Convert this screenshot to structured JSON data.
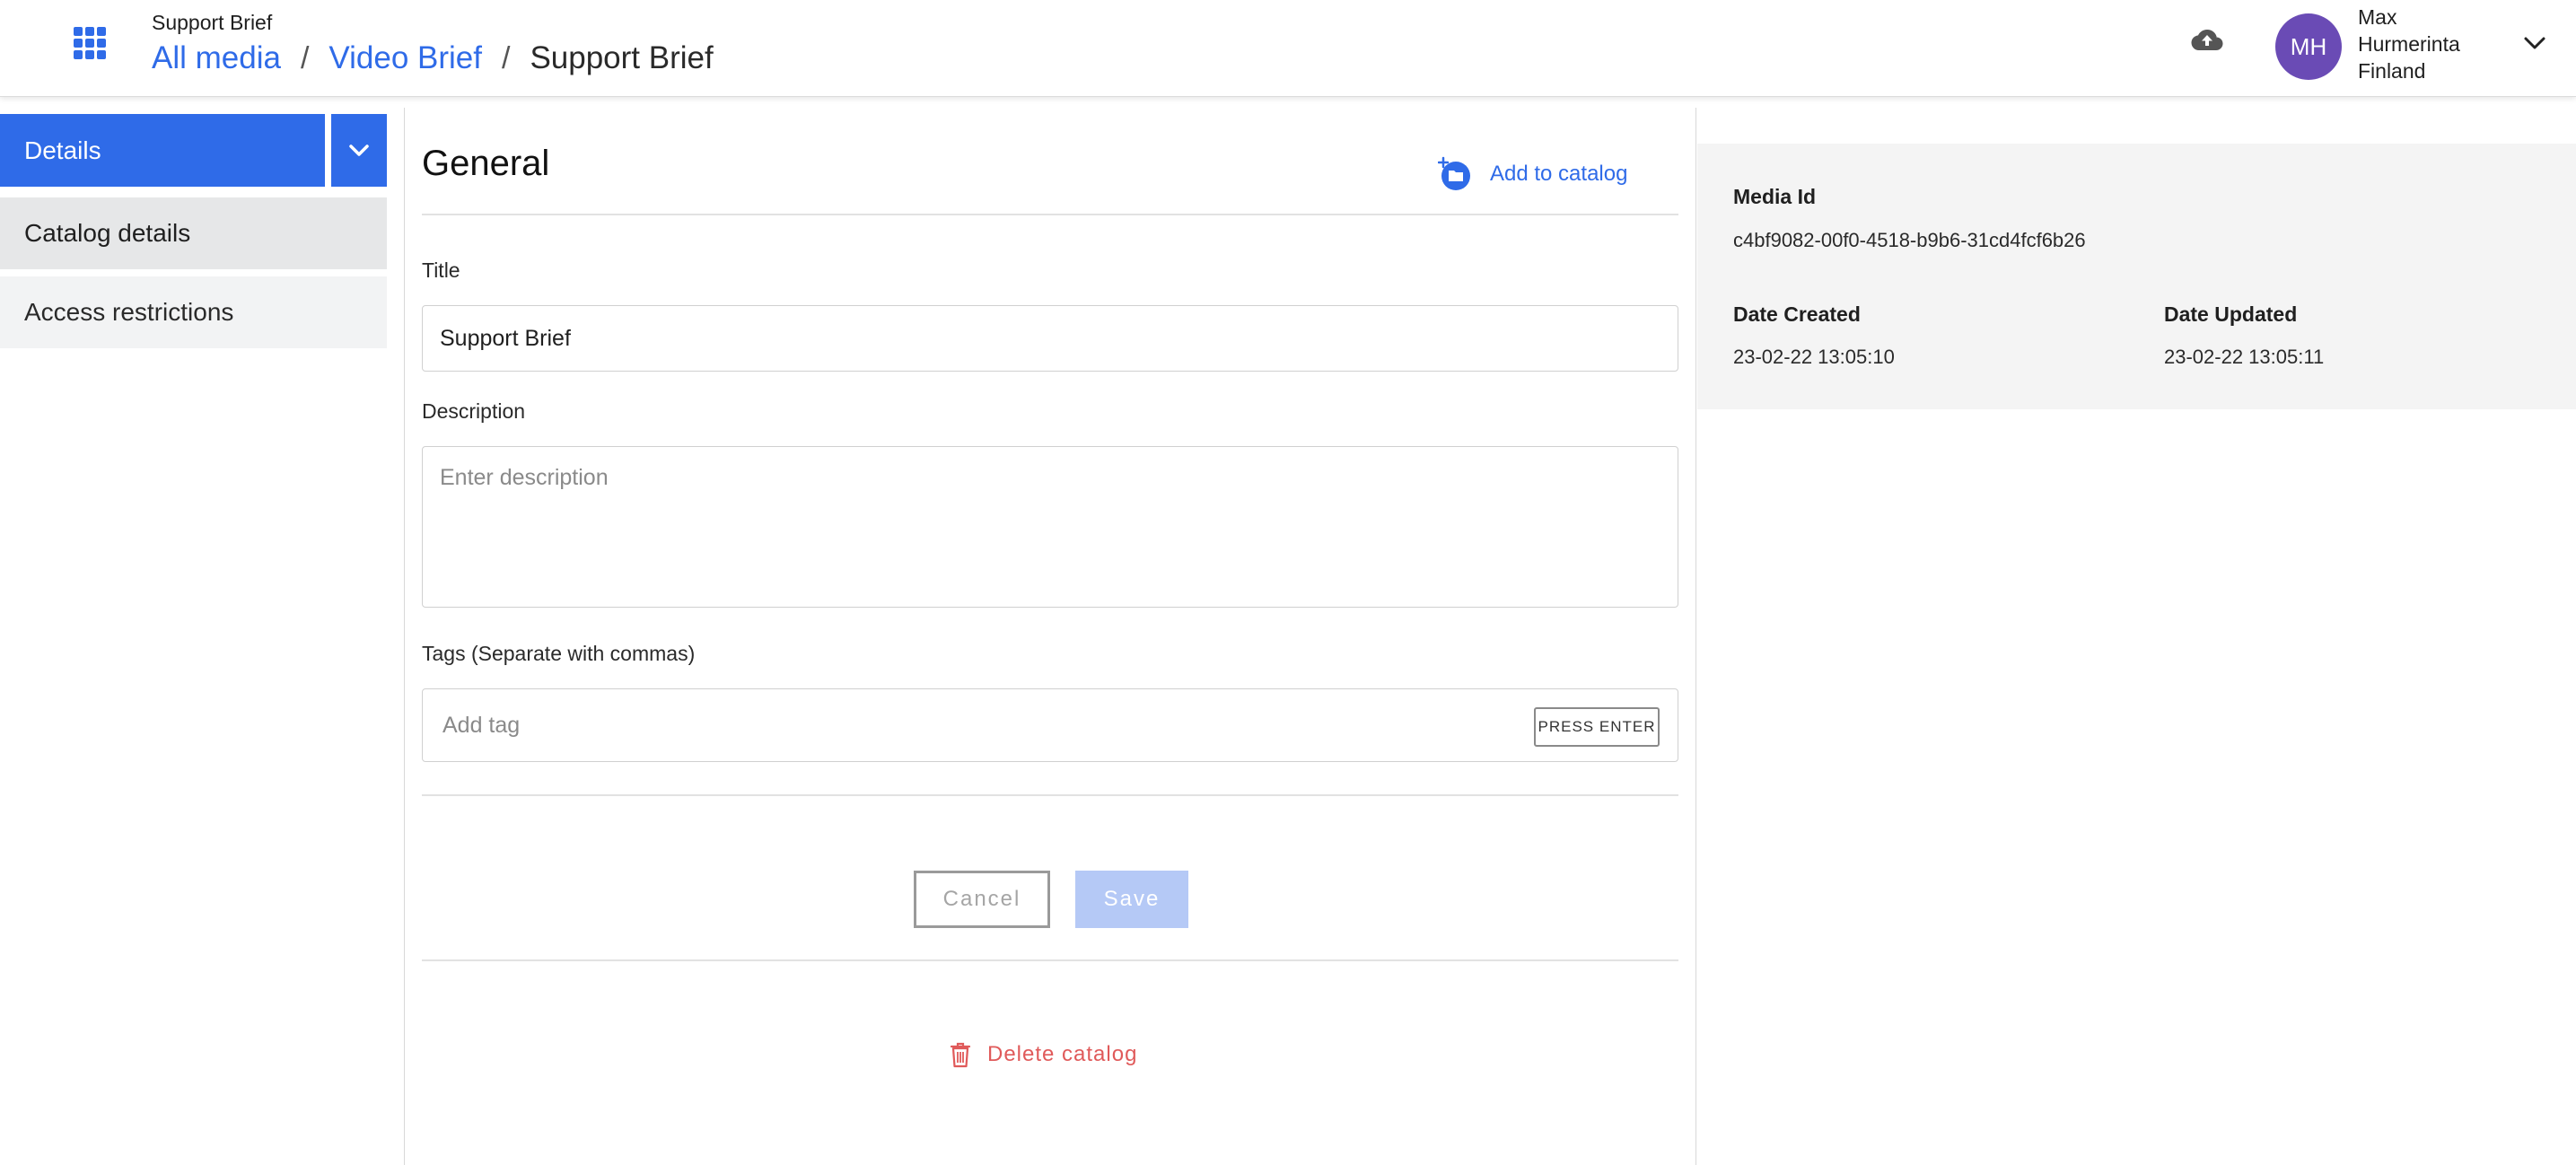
{
  "header": {
    "pre_title": "Support Brief",
    "breadcrumb": [
      {
        "label": "All media"
      },
      {
        "label": "Video Brief"
      },
      {
        "label": "Support Brief"
      }
    ],
    "separator": "/",
    "icons": {
      "apps": "apps-grid-icon",
      "upload": "cloud-upload-icon",
      "menu": "chevron-down-icon"
    },
    "user": {
      "initials": "MH",
      "first_name": "Max",
      "last_name": "Hurmerinta",
      "location": "Finland",
      "avatar_color": "#6a4bb5"
    }
  },
  "sidebar": {
    "selected": "Details",
    "items": [
      {
        "label": "Catalog details",
        "active": true
      },
      {
        "label": "Access restrictions",
        "active": false
      }
    ]
  },
  "form": {
    "section_title": "General",
    "add_to_catalog_label": "Add to catalog",
    "title_label": "Title",
    "title_value": "Support Brief",
    "description_label": "Description",
    "description_placeholder": "Enter description",
    "tags_label": "Tags (Separate with commas)",
    "tags_placeholder": "Add tag",
    "press_enter_label": "PRESS ENTER",
    "cancel_label": "Cancel",
    "save_label": "Save",
    "delete_label": "Delete catalog"
  },
  "info": {
    "media_id_label": "Media Id",
    "media_id_value": "c4bf9082-00f0-4518-b9b6-31cd4fcf6b26",
    "date_created_label": "Date Created",
    "date_created_value": "23-02-22 13:05:10",
    "date_updated_label": "Date Updated",
    "date_updated_value": "23-02-22 13:05:11"
  },
  "colors": {
    "accent": "#2f6be8",
    "save_disabled": "#b5c9f6",
    "danger": "#e05a5a"
  }
}
